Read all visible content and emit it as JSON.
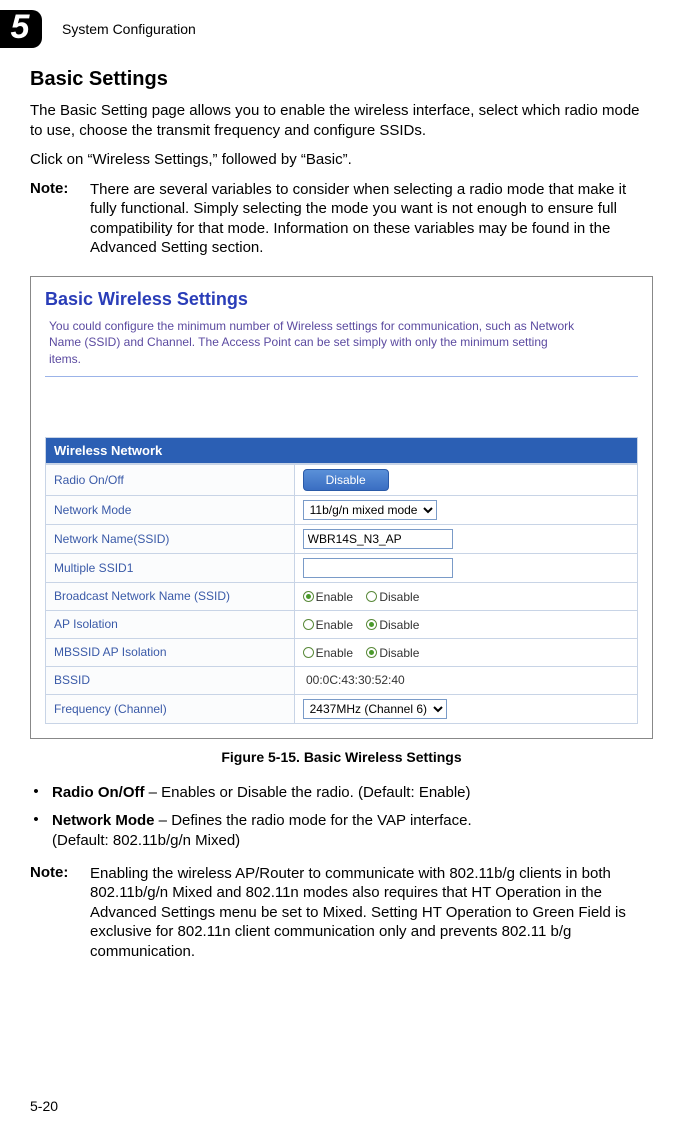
{
  "header": {
    "chapter_number": "5",
    "chapter_caption": "System Configuration"
  },
  "section_title": "Basic Settings",
  "intro_p1": "The Basic Setting page allows you to enable the wireless interface, select which radio mode to use, choose the transmit frequency and configure SSIDs.",
  "intro_p2": "Click on “Wireless Settings,” followed by “Basic”.",
  "note1": {
    "label": "Note:",
    "text": "There are several variables to consider when selecting a radio mode that make it fully functional. Simply selecting the mode you want is not enough to ensure full compatibility for that mode. Information on these variables may be found in the Advanced Setting section."
  },
  "figure": {
    "title": "Basic Wireless Settings",
    "subtitle": "You could configure the minimum number of Wireless settings for communication, such as Network Name (SSID) and Channel. The Access Point can be set simply with only the minimum setting items.",
    "table_header": "Wireless Network",
    "rows": {
      "radio_onoff": {
        "label": "Radio On/Off",
        "button": "Disable"
      },
      "network_mode": {
        "label": "Network Mode",
        "value": "11b/g/n mixed mode"
      },
      "ssid": {
        "label": "Network Name(SSID)",
        "value": "WBR14S_N3_AP"
      },
      "mssid1": {
        "label": "Multiple SSID1",
        "value": ""
      },
      "broadcast": {
        "label": "Broadcast Network Name (SSID)",
        "enable": "Enable",
        "disable": "Disable"
      },
      "ap_iso": {
        "label": "AP Isolation",
        "enable": "Enable",
        "disable": "Disable"
      },
      "mbssid": {
        "label": "MBSSID AP Isolation",
        "enable": "Enable",
        "disable": "Disable"
      },
      "bssid": {
        "label": "BSSID",
        "value": "00:0C:43:30:52:40"
      },
      "freq": {
        "label": "Frequency (Channel)",
        "value": "2437MHz (Channel 6)"
      }
    }
  },
  "figure_caption": "Figure 5-15.   Basic Wireless Settings",
  "bullets": {
    "b1_bold": "Radio On/Off",
    "b1_rest": " – Enables or Disable the radio. (Default: Enable)",
    "b2_bold": "Network Mode",
    "b2_rest_line1": " – Defines the radio mode for the VAP interface.",
    "b2_rest_line2": "(Default: 802.11b/g/n Mixed)"
  },
  "note2": {
    "label": "Note:",
    "text": "Enabling the wireless AP/Router to communicate with 802.11b/g clients in both 802.11b/g/n Mixed and 802.11n modes also requires that HT Operation in the Advanced Settings menu be set to Mixed. Setting HT Operation to Green Field is exclusive for 802.11n client communication only and prevents 802.11 b/g communication."
  },
  "page_number": "5-20"
}
